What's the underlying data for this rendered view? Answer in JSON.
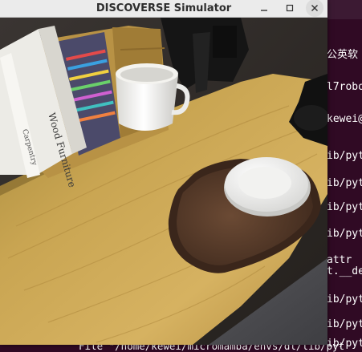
{
  "window": {
    "title": "DISCOVERSE Simulator",
    "buttons": {
      "minimize_icon": "minimize-icon",
      "maximize_icon": "maximize-icon",
      "close_icon": "close-icon"
    }
  },
  "scene": {
    "objects": [
      "books",
      "book-stand",
      "coffee-mug",
      "robot-gripper",
      "wooden-table",
      "serving-tray",
      "white-plate"
    ],
    "book_titles": [
      "Wood Furniture",
      "Carpentry"
    ]
  },
  "terminal": {
    "lines": [
      "公英软",
      "l7robo",
      "kewei@",
      "ib/pyt",
      "ib/pyt",
      "ib/pyt",
      "ib/pyt",
      "  attr",
      "t.__de",
      "ib/pyt",
      "ib/pyt",
      "ib/pyt"
    ],
    "bottom_line": "File \"/home/kewei/micromamba/envs/dl/lib/pyt"
  },
  "colors": {
    "terminal_bg": "#300a24",
    "table_wood": "#c8a24f",
    "tray": "#4a3022"
  }
}
